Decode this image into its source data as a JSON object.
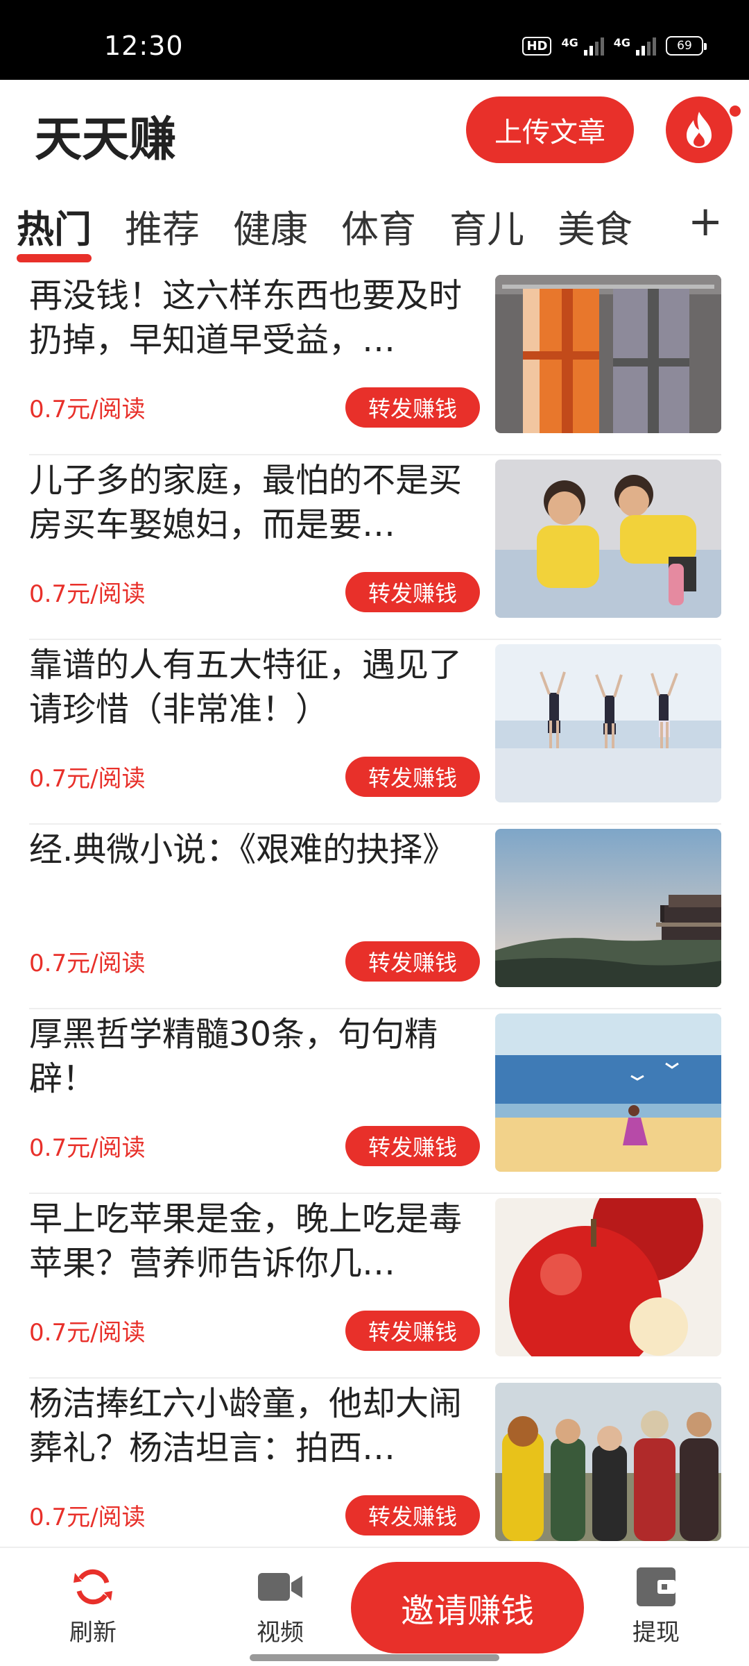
{
  "status_bar": {
    "time": "12:30",
    "hd_badge": "HD",
    "net1": "4G",
    "net2": "4G",
    "battery": "69"
  },
  "header": {
    "title": "天天赚",
    "upload_label": "上传文章",
    "fire_icon": "fire-icon"
  },
  "tabs": {
    "items": [
      {
        "label": "热门",
        "active": true
      },
      {
        "label": "推荐"
      },
      {
        "label": "健康"
      },
      {
        "label": "体育"
      },
      {
        "label": "育儿"
      },
      {
        "label": "美食"
      }
    ],
    "plus": "+"
  },
  "feed": {
    "items": [
      {
        "title": "再没钱！这六样东西也要及时扔掉，早知道早受益，…",
        "price": "0.7元/阅读",
        "share": "转发赚钱"
      },
      {
        "title": "儿子多的家庭，最怕的不是买房买车娶媳妇，而是要…",
        "price": "0.7元/阅读",
        "share": "转发赚钱"
      },
      {
        "title": "靠谱的人有五大特征，遇见了请珍惜（非常准！）",
        "price": "0.7元/阅读",
        "share": "转发赚钱"
      },
      {
        "title": "经.典微小说：《艰难的抉择》",
        "price": "0.7元/阅读",
        "share": "转发赚钱"
      },
      {
        "title": "厚黑哲学精髓30条，句句精辟！",
        "price": "0.7元/阅读",
        "share": "转发赚钱"
      },
      {
        "title": "早上吃苹果是金，晚上吃是毒苹果？营养师告诉你几…",
        "price": "0.7元/阅读",
        "share": "转发赚钱"
      },
      {
        "title": "杨洁捧红六小龄童，他却大闹葬礼？杨洁坦言：拍西…",
        "price": "0.7元/阅读",
        "share": "转发赚钱"
      }
    ]
  },
  "bottom_nav": {
    "refresh": "刷新",
    "video": "视频",
    "invite": "邀请赚钱",
    "withdraw": "提现"
  },
  "colors": {
    "accent": "#e8302a",
    "text": "#222222"
  }
}
